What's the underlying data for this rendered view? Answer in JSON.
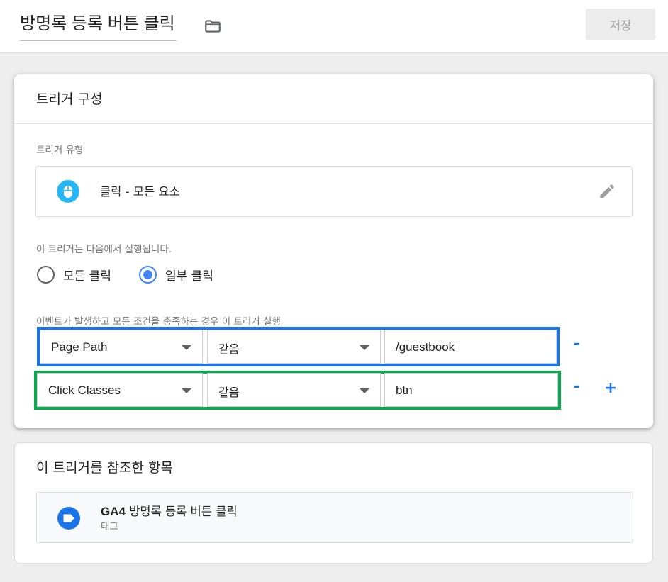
{
  "header": {
    "title": "방명록 등록 버튼 클릭",
    "folder_icon": "folder-icon",
    "save_label": "저장"
  },
  "trigger_config": {
    "card_title": "트리거 구성",
    "type_label": "트리거 유형",
    "type_value": "클릭 - 모든 요소",
    "type_icon": "mouse-icon",
    "edit_icon": "pencil-icon",
    "fires_on_label": "이 트리거는 다음에서 실행됩니다.",
    "radio_options": [
      {
        "label": "모든 클릭",
        "checked": false
      },
      {
        "label": "일부 클릭",
        "checked": true
      }
    ],
    "conditions_label": "이벤트가 발생하고 모든 조건을 충족하는 경우 이 트리거 실행",
    "conditions": [
      {
        "variable": "Page Path",
        "operator": "같음",
        "value": "/guestbook",
        "remove_label": "-",
        "highlight": "#1a73e8"
      },
      {
        "variable": "Click Classes",
        "operator": "같음",
        "value": "btn",
        "remove_label": "-",
        "add_label": "+",
        "highlight": "#0aa84f"
      }
    ]
  },
  "references": {
    "card_title": "이 트리거를 참조한 항목",
    "items": [
      {
        "name_prefix": "GA4",
        "name": " 방명록 등록 버튼 클릭",
        "type": "태그",
        "icon": "tag-icon"
      }
    ]
  },
  "colors": {
    "accent": "#1a73e8",
    "radio_checked": "#4285f4",
    "mouse_icon": "#29b6f6",
    "tag_icon": "#1a73e8"
  }
}
